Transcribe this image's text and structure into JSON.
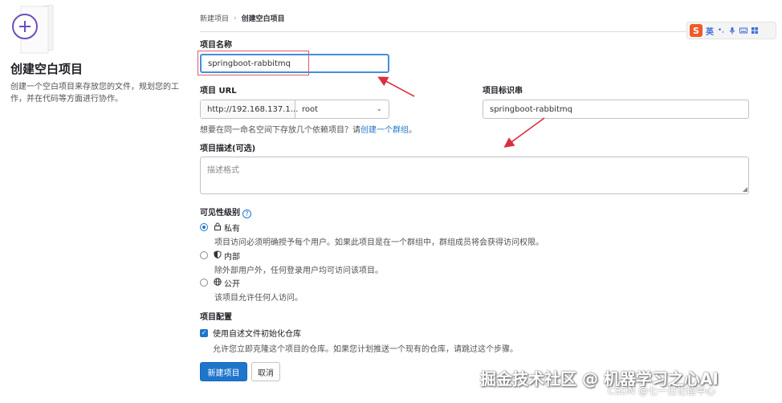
{
  "breadcrumb": {
    "parent": "新建项目",
    "separator": "›",
    "current": "创建空白项目"
  },
  "left_panel": {
    "title": "创建空白项目",
    "description": "创建一个空白项目来存放您的文件，规划您的工作，并在代码等方面进行协作。"
  },
  "ime_toolbar": {
    "logo": "S",
    "mode": "英",
    "icons": [
      "punctuation-icon",
      "mic-icon",
      "keyboard-icon",
      "grid-icon"
    ]
  },
  "form": {
    "project_name": {
      "label": "项目名称",
      "value": "springboot-rabbitmq"
    },
    "project_url": {
      "label": "项目 URL",
      "prefix": "http://192.168.137.1...",
      "namespace": "root"
    },
    "project_slug": {
      "label": "项目标识串",
      "value": "springboot-rabbitmq"
    },
    "group_hint": {
      "text": "想要在同一命名空间下存放几个依赖项目？请",
      "link": "创建一个群组",
      "end": "。"
    },
    "description": {
      "label": "项目描述(可选)",
      "placeholder": "描述格式"
    },
    "visibility": {
      "label": "可见性级别",
      "help_glyph": "?",
      "options": [
        {
          "title": "私有",
          "desc": "项目访问必须明确授予每个用户。如果此项目是在一个群组中，群组成员将会获得访问权限。",
          "selected": true,
          "icon": "lock-icon"
        },
        {
          "title": "内部",
          "desc": "除外部用户外，任何登录用户均可访问该项目。",
          "selected": false,
          "icon": "shield-icon"
        },
        {
          "title": "公开",
          "desc": "该项目允许任何人访问。",
          "selected": false,
          "icon": "globe-icon"
        }
      ]
    },
    "config": {
      "label": "项目配置",
      "readme_label": "使用自述文件初始化仓库",
      "readme_checked": true,
      "readme_desc": "允许您立即克隆这个项目的仓库。如果您计划推送一个现有的仓库，请跳过这个步骤。"
    },
    "buttons": {
      "create": "新建项目",
      "cancel": "取消"
    }
  },
  "watermark": {
    "main": "掘金技术社区 @ 机器学习之心AI",
    "sub": "CSDN @七一日记信中心"
  },
  "colors": {
    "primary": "#1f75cb",
    "annotation_red": "#d9303e",
    "sogou_orange": "#f05a28"
  }
}
